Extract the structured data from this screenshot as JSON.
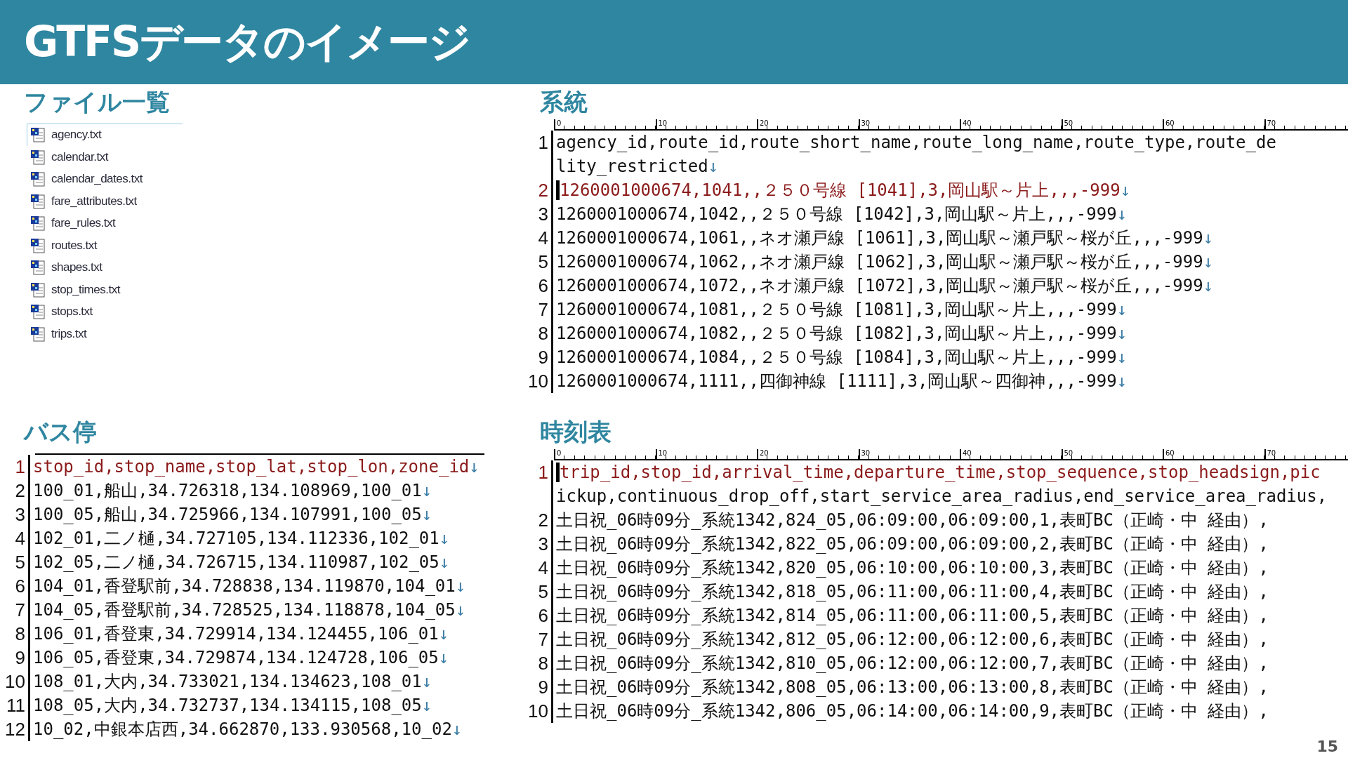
{
  "title": "GTFSデータのイメージ",
  "files": {
    "heading": "ファイル一覧",
    "items": [
      {
        "name": "agency.txt",
        "selected": true
      },
      {
        "name": "calendar.txt",
        "selected": false
      },
      {
        "name": "calendar_dates.txt",
        "selected": false
      },
      {
        "name": "fare_attributes.txt",
        "selected": false
      },
      {
        "name": "fare_rules.txt",
        "selected": false
      },
      {
        "name": "routes.txt",
        "selected": false
      },
      {
        "name": "shapes.txt",
        "selected": false
      },
      {
        "name": "stop_times.txt",
        "selected": false
      },
      {
        "name": "stops.txt",
        "selected": false
      },
      {
        "name": "trips.txt",
        "selected": false
      }
    ]
  },
  "routes": {
    "heading": "系統",
    "ruler_marks": [
      "0",
      "10",
      "20",
      "30",
      "40",
      "50",
      "60",
      "70"
    ],
    "rows": [
      {
        "number": "1",
        "text": "agency_id,route_id,route_short_name,route_long_name,route_type,route_de",
        "highlighted": false,
        "cursor": false
      },
      {
        "text": "lity_restricted",
        "eol": "↓",
        "highlighted": false,
        "cursor": false
      },
      {
        "number": "2",
        "text": "1260001000674,1041,,２５０号線 [1041],3,岡山駅～片上,,,-999",
        "eol": "↓",
        "highlighted": true,
        "cursor": true
      },
      {
        "number": "3",
        "text": "1260001000674,1042,,２５０号線 [1042],3,岡山駅～片上,,,-999",
        "eol": "↓",
        "highlighted": false,
        "cursor": false
      },
      {
        "number": "4",
        "text": "1260001000674,1061,,ネオ瀬戸線 [1061],3,岡山駅～瀬戸駅～桜が丘,,,-999",
        "eol": "↓",
        "highlighted": false,
        "cursor": false
      },
      {
        "number": "5",
        "text": "1260001000674,1062,,ネオ瀬戸線 [1062],3,岡山駅～瀬戸駅～桜が丘,,,-999",
        "eol": "↓",
        "highlighted": false,
        "cursor": false
      },
      {
        "number": "6",
        "text": "1260001000674,1072,,ネオ瀬戸線 [1072],3,岡山駅～瀬戸駅～桜が丘,,,-999",
        "eol": "↓",
        "highlighted": false,
        "cursor": false
      },
      {
        "number": "7",
        "text": "1260001000674,1081,,２５０号線 [1081],3,岡山駅～片上,,,-999",
        "eol": "↓",
        "highlighted": false,
        "cursor": false
      },
      {
        "number": "8",
        "text": "1260001000674,1082,,２５０号線 [1082],3,岡山駅～片上,,,-999",
        "eol": "↓",
        "highlighted": false,
        "cursor": false
      },
      {
        "number": "9",
        "text": "1260001000674,1084,,２５０号線 [1084],3,岡山駅～片上,,,-999",
        "eol": "↓",
        "highlighted": false,
        "cursor": false
      },
      {
        "number": "10",
        "text": "1260001000674,1111,,四御神線 [1111],3,岡山駅～四御神,,,-999",
        "eol": "↓",
        "highlighted": false,
        "cursor": false
      }
    ]
  },
  "stops": {
    "heading": "バス停",
    "rows": [
      {
        "number": "1",
        "text": "stop_id,stop_name,stop_lat,stop_lon,zone_id",
        "eol": "↓",
        "highlighted": true,
        "cursor": false
      },
      {
        "number": "2",
        "text": "100_01,船山,34.726318,134.108969,100_01",
        "eol": "↓",
        "highlighted": false,
        "cursor": false
      },
      {
        "number": "3",
        "text": "100_05,船山,34.725966,134.107991,100_05",
        "eol": "↓",
        "highlighted": false,
        "cursor": false
      },
      {
        "number": "4",
        "text": "102_01,二ノ樋,34.727105,134.112336,102_01",
        "eol": "↓",
        "highlighted": false,
        "cursor": false
      },
      {
        "number": "5",
        "text": "102_05,二ノ樋,34.726715,134.110987,102_05",
        "eol": "↓",
        "highlighted": false,
        "cursor": false
      },
      {
        "number": "6",
        "text": "104_01,香登駅前,34.728838,134.119870,104_01",
        "eol": "↓",
        "highlighted": false,
        "cursor": false
      },
      {
        "number": "7",
        "text": "104_05,香登駅前,34.728525,134.118878,104_05",
        "eol": "↓",
        "highlighted": false,
        "cursor": false
      },
      {
        "number": "8",
        "text": "106_01,香登東,34.729914,134.124455,106_01",
        "eol": "↓",
        "highlighted": false,
        "cursor": false
      },
      {
        "number": "9",
        "text": "106_05,香登東,34.729874,134.124728,106_05",
        "eol": "↓",
        "highlighted": false,
        "cursor": false
      },
      {
        "number": "10",
        "text": "108_01,大内,34.733021,134.134623,108_01",
        "eol": "↓",
        "highlighted": false,
        "cursor": false
      },
      {
        "number": "11",
        "text": "108_05,大内,34.732737,134.134115,108_05",
        "eol": "↓",
        "highlighted": false,
        "cursor": false
      },
      {
        "number": "12",
        "text": "10_02,中銀本店西,34.662870,133.930568,10_02",
        "eol": "↓",
        "highlighted": false,
        "cursor": false
      }
    ]
  },
  "stop_times": {
    "heading": "時刻表",
    "ruler_marks": [
      "0",
      "10",
      "20",
      "30",
      "40",
      "50",
      "60",
      "70"
    ],
    "rows": [
      {
        "number": "1",
        "text": "trip_id,stop_id,arrival_time,departure_time,stop_sequence,stop_headsign,pic",
        "highlighted": true,
        "cursor": true
      },
      {
        "text": "ickup,continuous_drop_off,start_service_area_radius,end_service_area_radius,",
        "highlighted": false,
        "cursor": false
      },
      {
        "number": "2",
        "text": "土日祝_06時09分_系統1342,824_05,06:09:00,06:09:00,1,表町BC（正崎・中 経由）,",
        "highlighted": false,
        "cursor": false
      },
      {
        "number": "3",
        "text": "土日祝_06時09分_系統1342,822_05,06:09:00,06:09:00,2,表町BC（正崎・中 経由）,",
        "highlighted": false,
        "cursor": false
      },
      {
        "number": "4",
        "text": "土日祝_06時09分_系統1342,820_05,06:10:00,06:10:00,3,表町BC（正崎・中 経由）,",
        "highlighted": false,
        "cursor": false
      },
      {
        "number": "5",
        "text": "土日祝_06時09分_系統1342,818_05,06:11:00,06:11:00,4,表町BC（正崎・中 経由）,",
        "highlighted": false,
        "cursor": false
      },
      {
        "number": "6",
        "text": "土日祝_06時09分_系統1342,814_05,06:11:00,06:11:00,5,表町BC（正崎・中 経由）,",
        "highlighted": false,
        "cursor": false
      },
      {
        "number": "7",
        "text": "土日祝_06時09分_系統1342,812_05,06:12:00,06:12:00,6,表町BC（正崎・中 経由）,",
        "highlighted": false,
        "cursor": false
      },
      {
        "number": "8",
        "text": "土日祝_06時09分_系統1342,810_05,06:12:00,06:12:00,7,表町BC（正崎・中 経由）,",
        "highlighted": false,
        "cursor": false
      },
      {
        "number": "9",
        "text": "土日祝_06時09分_系統1342,808_05,06:13:00,06:13:00,8,表町BC（正崎・中 経由）,",
        "highlighted": false,
        "cursor": false
      },
      {
        "number": "10",
        "text": "土日祝_06時09分_系統1342,806_05,06:14:00,06:14:00,9,表町BC（正崎・中 経由）,",
        "highlighted": false,
        "cursor": false
      }
    ]
  },
  "page_number": "15"
}
